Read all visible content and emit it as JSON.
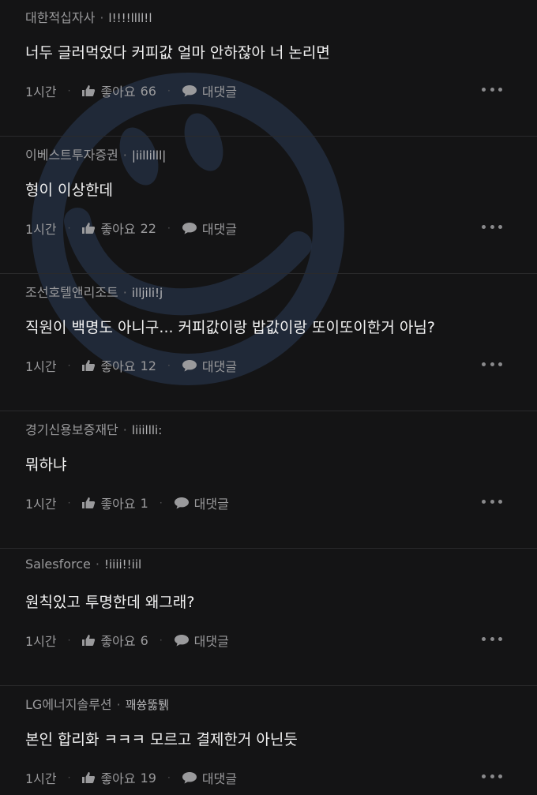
{
  "comments": [
    {
      "company": "대한적십자사",
      "nickname": "l!!!!llll!l",
      "text": "너두 글러먹었다 커피값 얼마 안하잖아 너 논리면",
      "time": "1시간",
      "like_label": "좋아요",
      "likes": "66",
      "reply_label": "대댓글"
    },
    {
      "company": "이베스트투자증권",
      "nickname": "|iillilll|",
      "text": "형이 이상한데",
      "time": "1시간",
      "like_label": "좋아요",
      "likes": "22",
      "reply_label": "대댓글"
    },
    {
      "company": "조선호텔앤리조트",
      "nickname": "illjili!j",
      "text": "직원이 백명도 아니구... 커피값이랑 밥값이랑 또이또이한거 아님?",
      "time": "1시간",
      "like_label": "좋아요",
      "likes": "12",
      "reply_label": "대댓글"
    },
    {
      "company": "경기신용보증재단",
      "nickname": "liiillli:",
      "text": "뭐하냐",
      "time": "1시간",
      "like_label": "좋아요",
      "likes": "1",
      "reply_label": "대댓글"
    },
    {
      "company": "Salesforce",
      "nickname": "!iiii!!iil",
      "text": "원칙있고 투명한데 왜그래?",
      "time": "1시간",
      "like_label": "좋아요",
      "likes": "6",
      "reply_label": "대댓글"
    },
    {
      "company": "LG에너지솔루션",
      "nickname": "꽤쓩뚫퉭",
      "text": "본인 합리화 ㅋㅋㅋ 모르고 결제한거 아닌듯",
      "time": "1시간",
      "like_label": "좋아요",
      "likes": "19",
      "reply_label": "대댓글"
    }
  ],
  "colors": {
    "background": "#141415",
    "text": "#f2f2f2",
    "muted": "#9a9a9c",
    "divider": "#2a2a2c"
  },
  "icons": {
    "like": "thumbs-up-icon",
    "reply": "speech-bubble-icon",
    "more": "more-dots-icon",
    "watermark": "smiley-watermark"
  }
}
